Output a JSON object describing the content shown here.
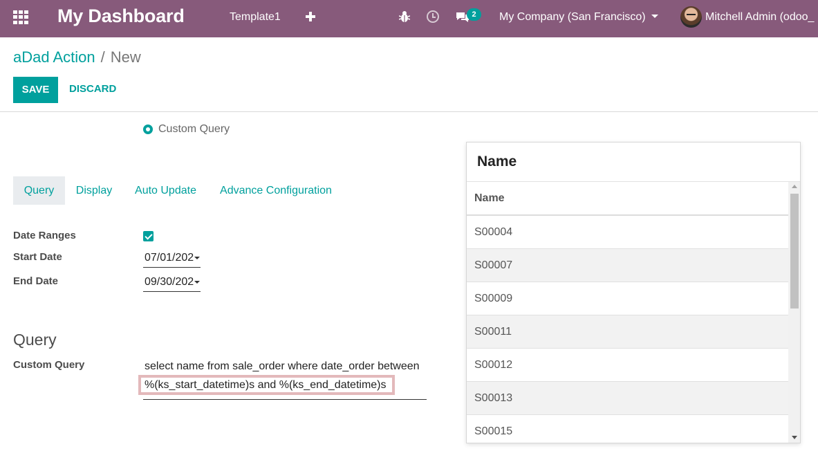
{
  "navbar": {
    "brand": "My Dashboard",
    "menu_item": "Template1",
    "messages_count": "2",
    "company": "My Company (San Francisco)",
    "user": "Mitchell Admin (odoo_",
    "background_color": "#875a7b",
    "icons": [
      "apps-icon",
      "plus-icon",
      "bug-icon",
      "clock-icon",
      "chat-icon",
      "chevron-down-icon",
      "avatar"
    ]
  },
  "breadcrumb": {
    "parent": "aDad Action",
    "separator": "/",
    "current": "New"
  },
  "buttons": {
    "save": "SAVE",
    "discard": "DISCARD"
  },
  "form": {
    "data_source_option": "Custom Query",
    "tabs": [
      "Query",
      "Display",
      "Auto Update",
      "Advance Configuration"
    ],
    "active_tab": "Query",
    "date_ranges_label": "Date Ranges",
    "date_ranges_checked": true,
    "start_date_label": "Start Date",
    "start_date_value": "07/01/202",
    "end_date_label": "End Date",
    "end_date_value": "09/30/202",
    "section_title": "Query",
    "custom_query_label": "Custom Query",
    "custom_query_line1": "select name from sale_order where date_order between",
    "custom_query_line2": "%(ks_start_datetime)s and %(ks_end_datetime)s"
  },
  "result_popup": {
    "title": "Name",
    "column_header": "Name",
    "rows": [
      "S00004",
      "S00007",
      "S00009",
      "S00011",
      "S00012",
      "S00013",
      "S00015"
    ]
  },
  "colors": {
    "accent": "#00a09d",
    "highlight_border": "#e3b9bb"
  }
}
